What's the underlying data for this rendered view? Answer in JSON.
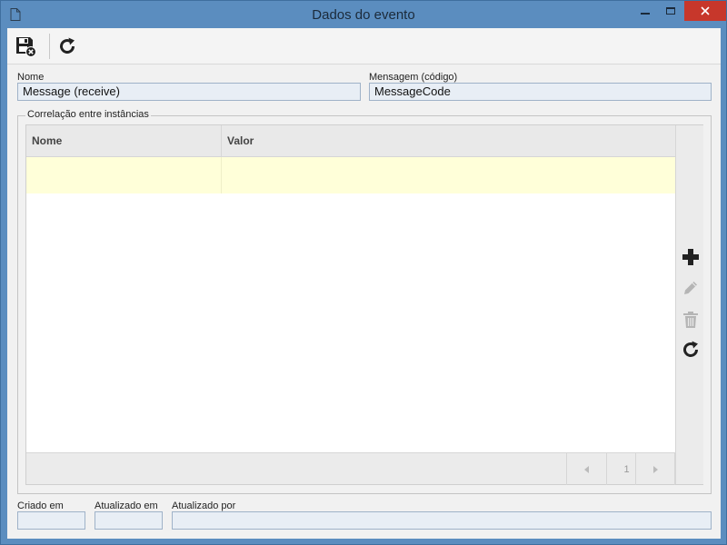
{
  "window": {
    "title": "Dados do evento",
    "icons": {
      "document": "document-icon",
      "minimize": "minimize-icon",
      "maximize": "maximize-icon",
      "close": "close-icon"
    },
    "close_color": "#c7372b"
  },
  "toolbar": {
    "save_icon": "save-close-icon",
    "refresh_icon": "refresh-icon"
  },
  "fields": {
    "nome": {
      "label": "Nome",
      "value": "Message (receive)"
    },
    "mensagem": {
      "label": "Mensagem (código)",
      "value": "MessageCode"
    }
  },
  "correlation": {
    "legend": "Correlação entre instâncias",
    "columns": [
      "Nome",
      "Valor"
    ],
    "rows": [
      {
        "nome": "",
        "valor": ""
      }
    ],
    "actions": [
      "add-icon",
      "edit-icon",
      "delete-icon",
      "refresh-icon"
    ],
    "pager": {
      "page": "1"
    }
  },
  "footer": {
    "criado_em": {
      "label": "Criado em",
      "value": ""
    },
    "atualizado_em": {
      "label": "Atualizado em",
      "value": ""
    },
    "atualizado_por": {
      "label": "Atualizado por",
      "value": ""
    }
  },
  "colors": {
    "titlebar": "#5b8dbf",
    "selected_row": "#ffffd9",
    "field_bg": "#e8eef5"
  }
}
